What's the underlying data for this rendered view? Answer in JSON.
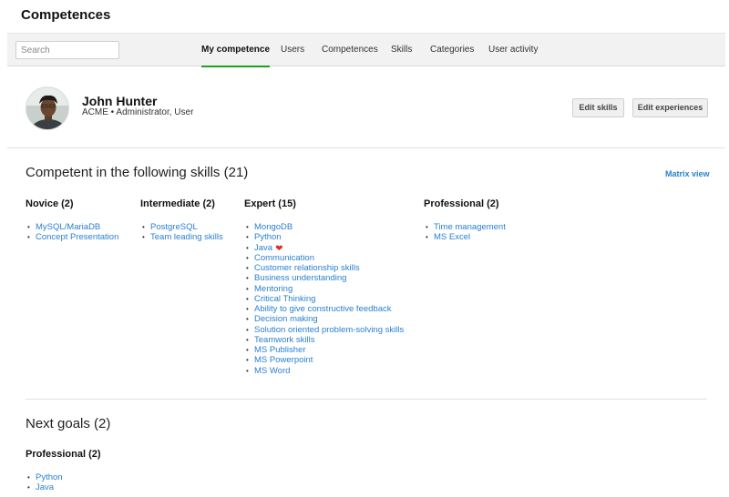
{
  "app": {
    "title": "Competences"
  },
  "search": {
    "placeholder": "Search",
    "value": ""
  },
  "nav": {
    "tabs": [
      {
        "label": "My competence",
        "active": true
      },
      {
        "label": "Users",
        "active": false
      },
      {
        "label": "Competences",
        "active": false
      },
      {
        "label": "Skills",
        "active": false
      },
      {
        "label": "Categories",
        "active": false
      },
      {
        "label": "User activity",
        "active": false
      }
    ]
  },
  "profile": {
    "name": "John Hunter",
    "org": "ACME",
    "roles": "Administrator, User",
    "subline": "ACME • Administrator, User"
  },
  "actions": {
    "edit_skills": "Edit skills",
    "edit_experiences": "Edit experiences"
  },
  "competent": {
    "title": "Competent in the following skills (21)",
    "matrix_link": "Matrix view",
    "levels": [
      {
        "heading": "Novice (2)",
        "skills": [
          "MySQL/MariaDB",
          "Concept Presentation"
        ]
      },
      {
        "heading": "Intermediate (2)",
        "skills": [
          "PostgreSQL",
          "Team leading skills"
        ]
      },
      {
        "heading": "Expert (15)",
        "skills": [
          "MongoDB",
          "Python",
          "Java",
          "Communication",
          "Customer relationship skills",
          "Business understanding",
          "Mentoring",
          "Critical Thinking",
          "Ability to give constructive feedback",
          "Decision making",
          "Solution oriented problem-solving skills",
          "Teamwork skills",
          "MS Publisher",
          "MS Powerpoint",
          "MS Word"
        ]
      },
      {
        "heading": "Professional (2)",
        "skills": [
          "Time management",
          "MS Excel"
        ]
      }
    ],
    "favorite_skill": "Java",
    "favorite_icon": "heart-icon",
    "colors": {
      "link": "#2a80d0",
      "active_tab": "#1ea01e",
      "heart": "#d9302a"
    }
  },
  "goals": {
    "title": "Next goals (2)",
    "levels": [
      {
        "heading": "Professional (2)",
        "skills": [
          "Python",
          "Java"
        ]
      }
    ]
  }
}
